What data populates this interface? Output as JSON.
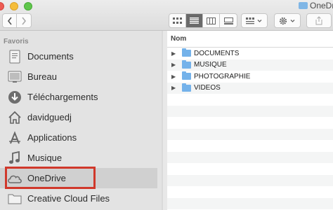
{
  "window": {
    "title": "OneDrive"
  },
  "toolbar": {
    "back_icon": "chevron-left-icon",
    "forward_icon": "chevron-right-icon",
    "view_modes": [
      "icon-view",
      "list-view",
      "column-view",
      "gallery-view"
    ],
    "active_view": "list-view",
    "arrange_icon": "grid-dropdown-icon",
    "action_icon": "gear-icon",
    "share_icon": "share-icon"
  },
  "sidebar": {
    "heading": "Favoris",
    "items": [
      {
        "label": "Documents",
        "icon": "documents-icon"
      },
      {
        "label": "Bureau",
        "icon": "desktop-icon"
      },
      {
        "label": "Téléchargements",
        "icon": "download-icon"
      },
      {
        "label": "davidguedj",
        "icon": "home-icon"
      },
      {
        "label": "Applications",
        "icon": "applications-icon"
      },
      {
        "label": "Musique",
        "icon": "music-icon"
      },
      {
        "label": "OneDrive",
        "icon": "cloud-icon",
        "selected": true
      },
      {
        "label": "Creative Cloud Files",
        "icon": "folder-icon"
      }
    ]
  },
  "content": {
    "column_header": "Nom",
    "rows": [
      {
        "name": "DOCUMENTS"
      },
      {
        "name": "MUSIQUE"
      },
      {
        "name": "PHOTOGRAPHIE"
      },
      {
        "name": "VIDEOS"
      }
    ]
  },
  "colors": {
    "highlight": "#d0382b",
    "folder": "#74b2ea"
  }
}
